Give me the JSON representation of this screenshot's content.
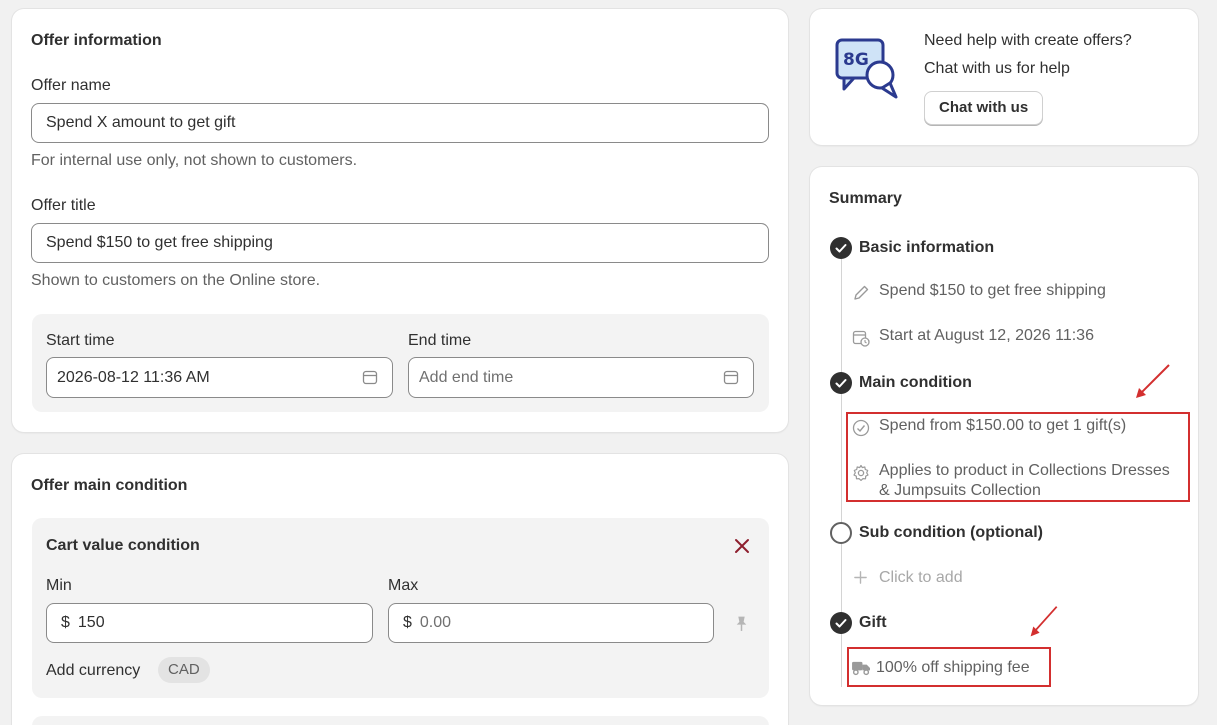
{
  "offer_info": {
    "heading": "Offer information",
    "name_label": "Offer name",
    "name_value": "Spend X amount to get gift",
    "name_help": "For internal use only, not shown to customers.",
    "title_label": "Offer title",
    "title_value": "Spend $150 to get free shipping",
    "title_help": "Shown to customers on the Online store.",
    "start_label": "Start time",
    "start_value": "2026-08-12 11:36 AM",
    "end_label": "End time",
    "end_placeholder": "Add end time"
  },
  "main_condition": {
    "heading": "Offer main condition",
    "box_title": "Cart value condition",
    "min_label": "Min",
    "min_prefix": "$",
    "min_value": "150",
    "max_label": "Max",
    "max_prefix": "$",
    "max_placeholder": "0.00",
    "add_currency": "Add currency",
    "currency_badge": "CAD"
  },
  "help_card": {
    "line1": "Need help with create offers?",
    "line2": "Chat with us for help",
    "button": "Chat with us",
    "logo_text": "8G"
  },
  "summary": {
    "heading": "Summary",
    "basic_title": "Basic information",
    "basic_item1": "Spend $150 to get free shipping",
    "basic_item2": "Start at August 12, 2026 11:36",
    "main_title": "Main condition",
    "main_item1": "Spend from $150.00 to get 1 gift(s)",
    "main_item2_line1": "Applies to product in Collections Dresses",
    "main_item2_line2": "& Jumpsuits Collection",
    "sub_title": "Sub condition (optional)",
    "sub_item": "Click to add",
    "gift_title": "Gift",
    "gift_item": "100% off shipping fee"
  },
  "colors": {
    "annotation": "#d32f2f",
    "remove": "#8e1f2e"
  }
}
